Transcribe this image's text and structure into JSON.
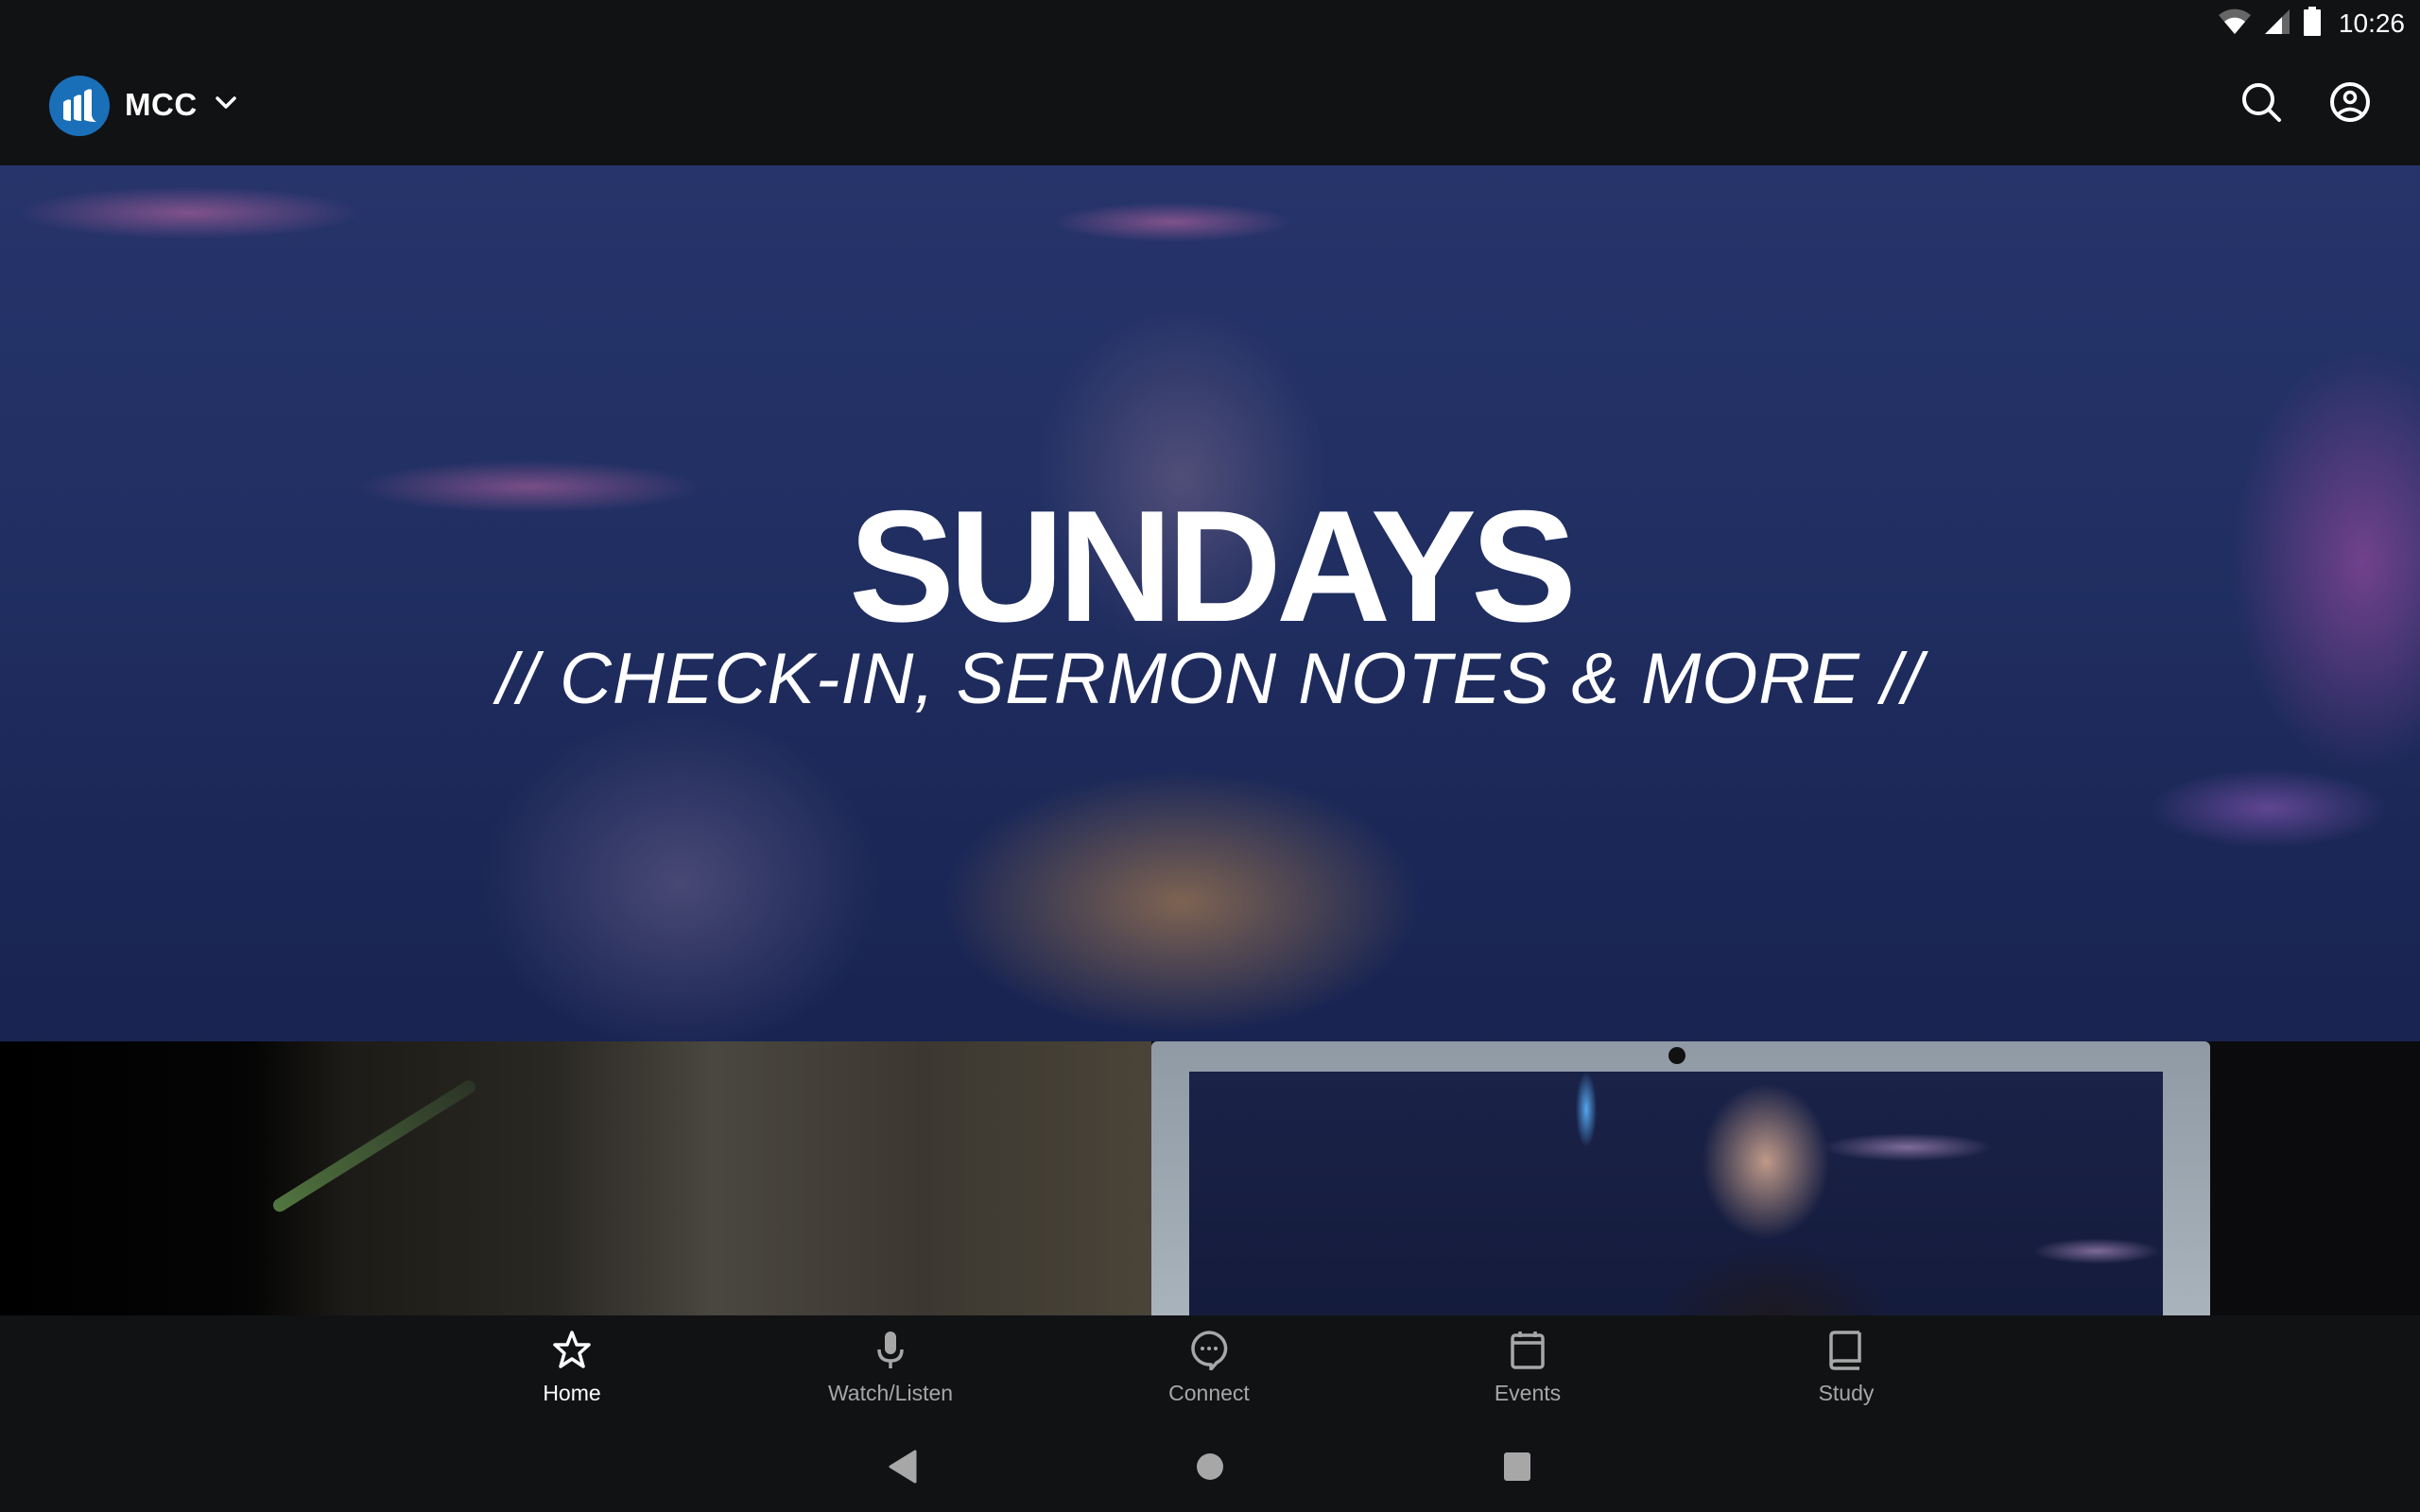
{
  "status_bar": {
    "time": "10:26",
    "icons": [
      "wifi-icon",
      "cellular-signal-icon",
      "battery-icon"
    ]
  },
  "app_bar": {
    "logo_icon": "mcc-logo",
    "brand_name": "MCC",
    "brand_dropdown_icon": "chevron-down-icon",
    "actions": [
      {
        "name": "search",
        "icon": "search-icon"
      },
      {
        "name": "profile",
        "icon": "account-circle-icon"
      }
    ]
  },
  "hero": {
    "title": "SUNDAYS",
    "subtitle": "// CHECK-IN, SERMON NOTES & MORE //"
  },
  "bottom_nav": {
    "active": "Home",
    "items": [
      {
        "label": "Home",
        "icon": "star-icon"
      },
      {
        "label": "Watch/Listen",
        "icon": "microphone-icon"
      },
      {
        "label": "Connect",
        "icon": "chat-bubble-icon"
      },
      {
        "label": "Events",
        "icon": "calendar-icon"
      },
      {
        "label": "Study",
        "icon": "book-icon"
      }
    ]
  },
  "system_nav": {
    "buttons": [
      "back",
      "home",
      "recents"
    ]
  },
  "colors": {
    "background": "#111214",
    "brand_blue": "#1a6fb9",
    "nav_active": "#ffffff",
    "nav_inactive": "#a7a7a7"
  }
}
